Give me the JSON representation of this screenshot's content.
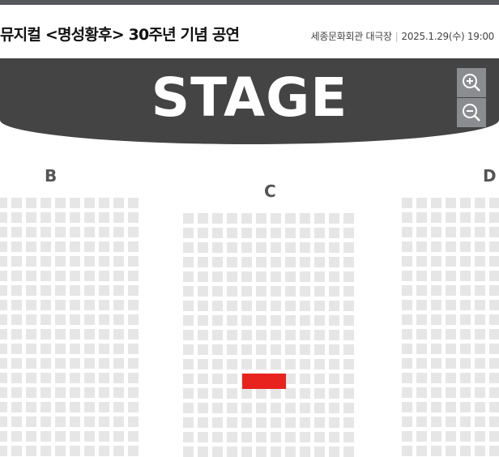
{
  "header": {
    "title": "뮤지컬 <명성황후> 30주년 기념 공연",
    "venue": "세종문화회관 대극장",
    "datetime": "2025.1.29(수) 19:00"
  },
  "stage": {
    "label": "STAGE",
    "zoom_in_icon": "zoom-in-icon",
    "zoom_out_icon": "zoom-out-icon"
  },
  "sections": [
    {
      "label": "B"
    },
    {
      "label": "C"
    },
    {
      "label": "D"
    }
  ],
  "colors": {
    "stage_bg": "#444444",
    "seat": "#e6e6e6",
    "selected_seat": "#e8221c",
    "zoom_button": "#8a8c90"
  },
  "selected_seat": {
    "section": "C",
    "row": 12
  }
}
